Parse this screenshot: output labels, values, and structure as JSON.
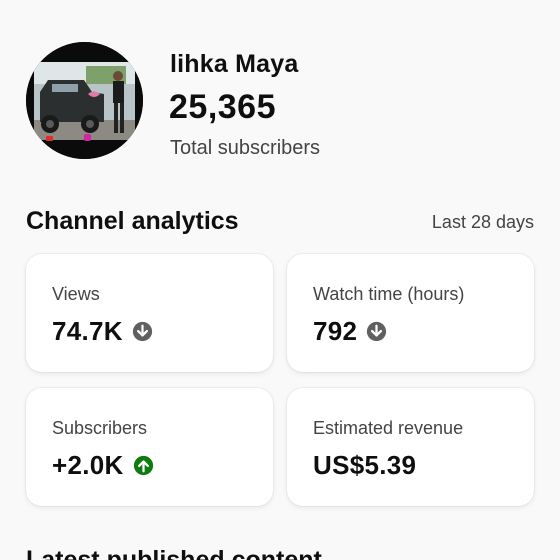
{
  "channel": {
    "name": "lihka Maya",
    "subscriber_count": "25,365",
    "subscriber_label": "Total subscribers"
  },
  "analytics": {
    "title": "Channel analytics",
    "period": "Last 28 days",
    "cards": [
      {
        "label": "Views",
        "value": "74.7K",
        "trend": "down",
        "trend_icon": "arrow-down-icon"
      },
      {
        "label": "Watch time (hours)",
        "value": "792",
        "trend": "down",
        "trend_icon": "arrow-down-icon"
      },
      {
        "label": "Subscribers",
        "value": "+2.0K",
        "trend": "up",
        "trend_icon": "arrow-up-icon"
      },
      {
        "label": "Estimated revenue",
        "value": "US$5.39"
      }
    ]
  },
  "next_section": {
    "title": "Latest published content"
  },
  "colors": {
    "trend_down": "#606060",
    "trend_up": "#0f7b0f",
    "background": "#f9f9f9",
    "card": "#ffffff"
  }
}
